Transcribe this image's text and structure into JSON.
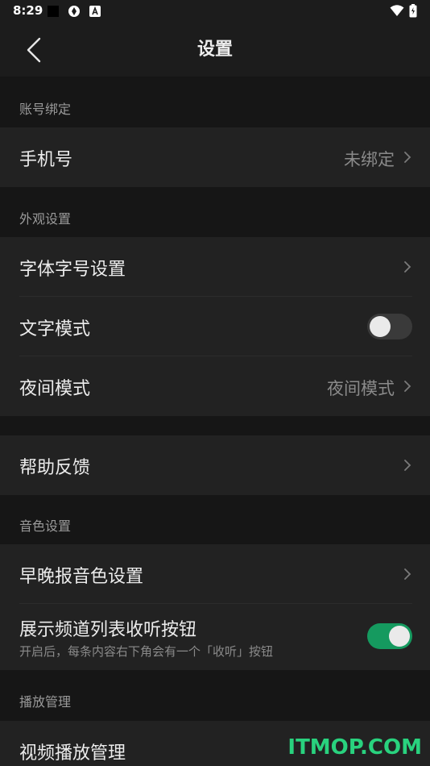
{
  "status_bar": {
    "time": "8:29"
  },
  "header": {
    "title": "设置",
    "back_icon": "chevron-left-icon"
  },
  "sections": {
    "account": {
      "header": "账号绑定",
      "phone": {
        "label": "手机号",
        "value": "未绑定"
      }
    },
    "appearance": {
      "header": "外观设置",
      "font": {
        "label": "字体字号设置"
      },
      "text_mode": {
        "label": "文字模式",
        "enabled": false
      },
      "night_mode": {
        "label": "夜间模式",
        "value": "夜间模式"
      }
    },
    "help": {
      "label": "帮助反馈"
    },
    "voice": {
      "header": "音色设置",
      "morning_evening": {
        "label": "早晚报音色设置"
      },
      "listen_button": {
        "label": "展示频道列表收听按钮",
        "subtitle": "开启后，每条内容右下角会有一个「收听」按钮",
        "enabled": true
      }
    },
    "playback": {
      "header": "播放管理",
      "video": {
        "label": "视频播放管理"
      }
    }
  },
  "watermark": "ITMOP.COM",
  "colors": {
    "accent": "#159a5f",
    "background": "#161616",
    "row": "#222222"
  }
}
